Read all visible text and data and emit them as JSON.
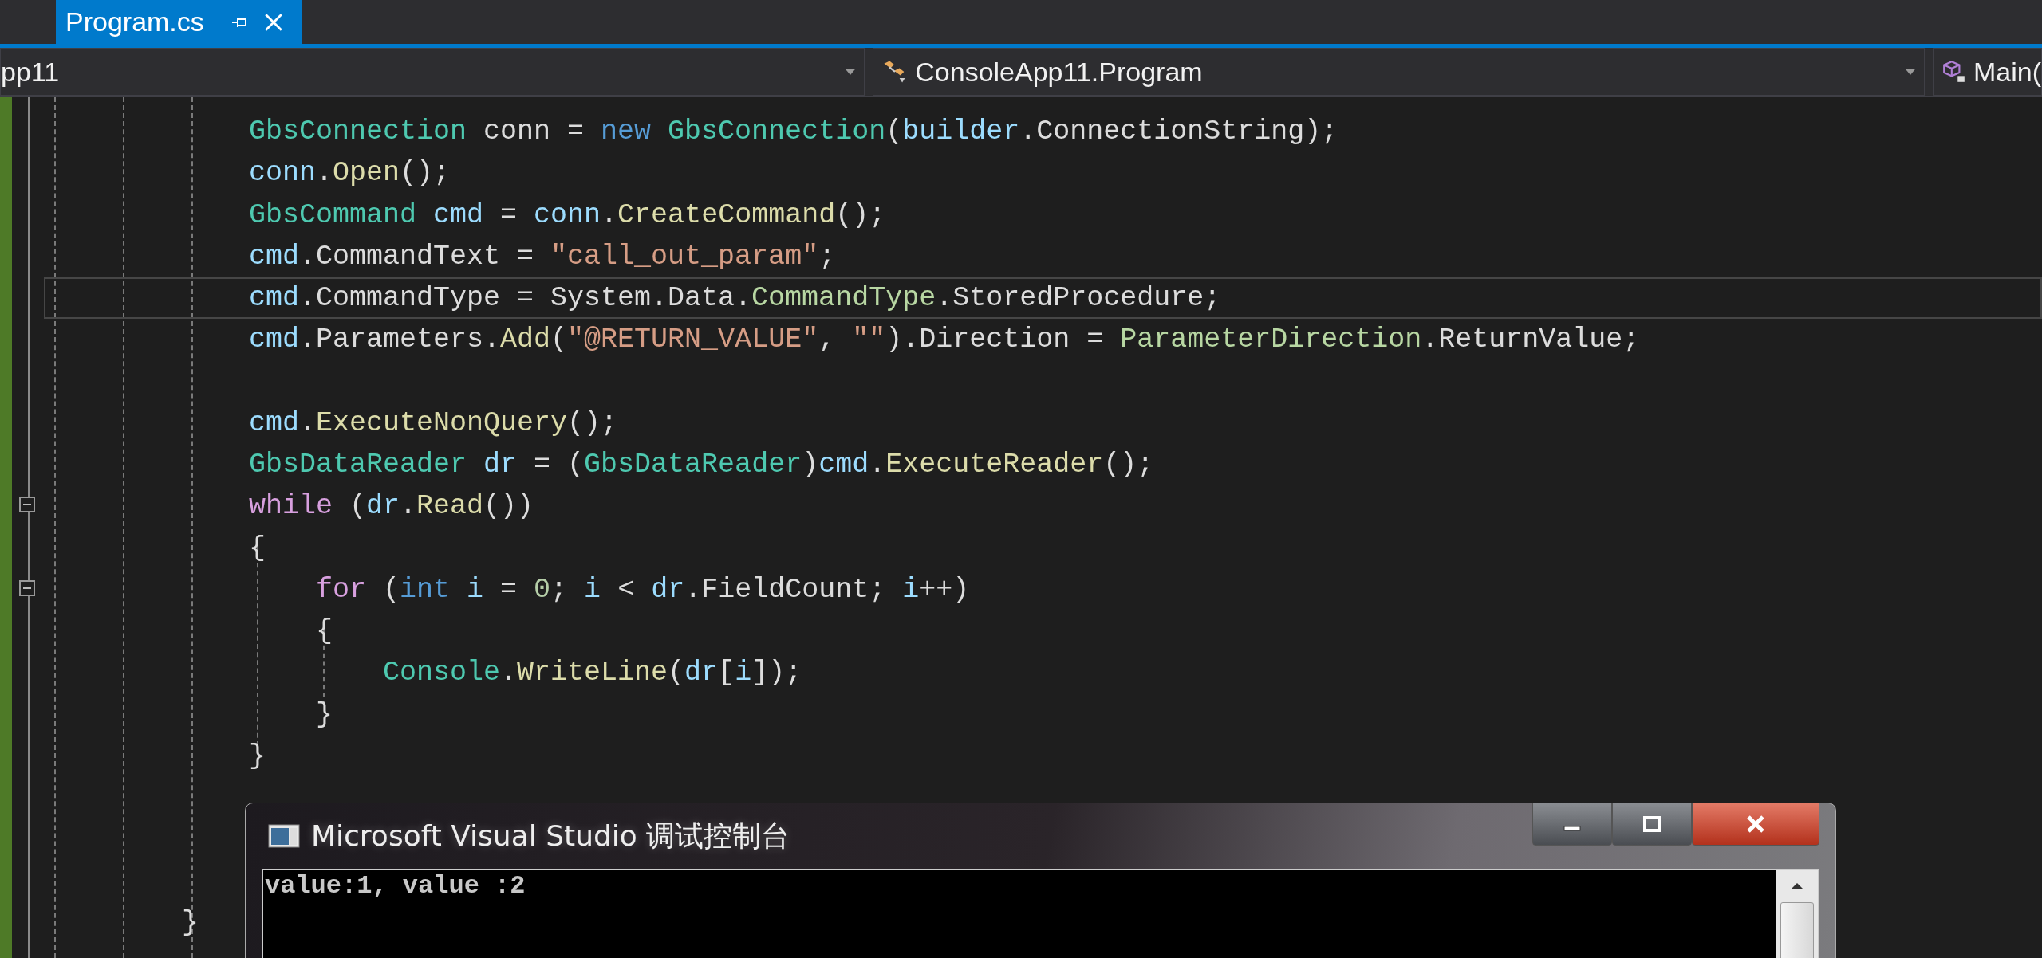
{
  "tabs": [
    {
      "label": "Program.cs",
      "selected": true
    }
  ],
  "navigation": {
    "project": "pp11",
    "type": "ConsoleApp11.Program",
    "member": "Main("
  },
  "code_lines": [
    {
      "kind": "block",
      "children": [
        {
          "kind": "code",
          "current": false,
          "collapse_box": false,
          "tokens": [
            {
              "kind": "type",
              "text": "GbsConnection"
            },
            {
              "kind": "plain",
              "text": " conn = "
            },
            {
              "kind": "keyword",
              "text": "new "
            },
            {
              "kind": "type",
              "text": "GbsConnection"
            },
            {
              "kind": "plain",
              "text": "("
            },
            {
              "kind": "variable",
              "text": "builder"
            },
            {
              "kind": "plain",
              "text": ".ConnectionString);"
            }
          ]
        },
        {
          "kind": "code",
          "current": false,
          "collapse_box": false,
          "tokens": [
            {
              "kind": "variable",
              "text": "conn"
            },
            {
              "kind": "plain",
              "text": "."
            },
            {
              "kind": "method",
              "text": "Open"
            },
            {
              "kind": "plain",
              "text": "();"
            }
          ]
        },
        {
          "kind": "code",
          "current": false,
          "collapse_box": false,
          "tokens": [
            {
              "kind": "type",
              "text": "GbsCommand "
            },
            {
              "kind": "variable",
              "text": "cmd"
            },
            {
              "kind": "plain",
              "text": " = "
            },
            {
              "kind": "variable",
              "text": "conn"
            },
            {
              "kind": "plain",
              "text": "."
            },
            {
              "kind": "method",
              "text": "CreateCommand"
            },
            {
              "kind": "plain",
              "text": "();"
            }
          ]
        },
        {
          "kind": "code",
          "current": false,
          "collapse_box": false,
          "tokens": [
            {
              "kind": "variable",
              "text": "cmd"
            },
            {
              "kind": "plain",
              "text": ".CommandText = "
            },
            {
              "kind": "string",
              "text": "\"call_out_param\""
            },
            {
              "kind": "plain",
              "text": ";"
            }
          ]
        },
        {
          "kind": "code",
          "current": true,
          "collapse_box": false,
          "tokens": [
            {
              "kind": "variable",
              "text": "cmd"
            },
            {
              "kind": "plain",
              "text": ".CommandType = System.Data."
            },
            {
              "kind": "enum",
              "text": "CommandType"
            },
            {
              "kind": "plain",
              "text": ".StoredProcedure;"
            }
          ]
        },
        {
          "kind": "code",
          "current": false,
          "collapse_box": false,
          "tokens": [
            {
              "kind": "variable",
              "text": "cmd"
            },
            {
              "kind": "plain",
              "text": ".Parameters."
            },
            {
              "kind": "method",
              "text": "Add"
            },
            {
              "kind": "plain",
              "text": "("
            },
            {
              "kind": "string",
              "text": "\"@RETURN_VALUE\""
            },
            {
              "kind": "plain",
              "text": ", "
            },
            {
              "kind": "string",
              "text": "\"\""
            },
            {
              "kind": "plain",
              "text": ").Direction = "
            },
            {
              "kind": "enum",
              "text": "ParameterDirection"
            },
            {
              "kind": "plain",
              "text": ".ReturnValue;"
            }
          ]
        },
        {
          "kind": "blank"
        },
        {
          "kind": "code",
          "current": false,
          "collapse_box": false,
          "tokens": [
            {
              "kind": "variable",
              "text": "cmd"
            },
            {
              "kind": "plain",
              "text": "."
            },
            {
              "kind": "method",
              "text": "ExecuteNonQuery"
            },
            {
              "kind": "plain",
              "text": "();"
            }
          ]
        },
        {
          "kind": "code",
          "current": false,
          "collapse_box": false,
          "tokens": [
            {
              "kind": "type",
              "text": "GbsDataReader "
            },
            {
              "kind": "variable",
              "text": "dr"
            },
            {
              "kind": "plain",
              "text": " = ("
            },
            {
              "kind": "type",
              "text": "GbsDataReader"
            },
            {
              "kind": "plain",
              "text": ")"
            },
            {
              "kind": "variable",
              "text": "cmd"
            },
            {
              "kind": "plain",
              "text": "."
            },
            {
              "kind": "method",
              "text": "ExecuteReader"
            },
            {
              "kind": "plain",
              "text": "();"
            }
          ]
        },
        {
          "kind": "code",
          "current": false,
          "collapse_box": true,
          "tokens": [
            {
              "kind": "control",
              "text": "while"
            },
            {
              "kind": "plain",
              "text": " ("
            },
            {
              "kind": "variable",
              "text": "dr"
            },
            {
              "kind": "plain",
              "text": "."
            },
            {
              "kind": "method",
              "text": "Read"
            },
            {
              "kind": "plain",
              "text": "())"
            }
          ]
        },
        {
          "kind": "code",
          "current": false,
          "collapse_box": false,
          "tokens": [
            {
              "kind": "plain",
              "text": "{"
            }
          ]
        },
        {
          "kind": "block",
          "children": [
            {
              "kind": "code",
              "current": false,
              "collapse_box": true,
              "tokens": [
                {
                  "kind": "control",
                  "text": "for"
                },
                {
                  "kind": "plain",
                  "text": " ("
                },
                {
                  "kind": "keyword",
                  "text": "int "
                },
                {
                  "kind": "variable",
                  "text": "i"
                },
                {
                  "kind": "plain",
                  "text": " = "
                },
                {
                  "kind": "number",
                  "text": "0"
                },
                {
                  "kind": "plain",
                  "text": "; "
                },
                {
                  "kind": "variable",
                  "text": "i"
                },
                {
                  "kind": "plain",
                  "text": " < "
                },
                {
                  "kind": "variable",
                  "text": "dr"
                },
                {
                  "kind": "plain",
                  "text": ".FieldCount; "
                },
                {
                  "kind": "variable",
                  "text": "i"
                },
                {
                  "kind": "plain",
                  "text": "++)"
                }
              ]
            },
            {
              "kind": "code",
              "current": false,
              "collapse_box": false,
              "tokens": [
                {
                  "kind": "plain",
                  "text": "{"
                }
              ]
            },
            {
              "kind": "block",
              "children": [
                {
                  "kind": "code",
                  "current": false,
                  "collapse_box": false,
                  "tokens": [
                    {
                      "kind": "type",
                      "text": "Console"
                    },
                    {
                      "kind": "plain",
                      "text": "."
                    },
                    {
                      "kind": "method",
                      "text": "WriteLine"
                    },
                    {
                      "kind": "plain",
                      "text": "("
                    },
                    {
                      "kind": "variable",
                      "text": "dr"
                    },
                    {
                      "kind": "plain",
                      "text": "["
                    },
                    {
                      "kind": "variable",
                      "text": "i"
                    },
                    {
                      "kind": "plain",
                      "text": "]);"
                    }
                  ]
                }
              ]
            },
            {
              "kind": "code",
              "current": false,
              "collapse_box": false,
              "tokens": [
                {
                  "kind": "plain",
                  "text": "}"
                }
              ]
            }
          ]
        },
        {
          "kind": "code",
          "current": false,
          "collapse_box": false,
          "tokens": [
            {
              "kind": "plain",
              "text": "}"
            }
          ]
        },
        {
          "kind": "blank"
        },
        {
          "kind": "blank"
        },
        {
          "kind": "blank"
        }
      ]
    },
    {
      "kind": "code",
      "current": false,
      "collapse_box": false,
      "tokens": [
        {
          "kind": "plain",
          "text": "}"
        }
      ]
    }
  ],
  "console_window": {
    "title": "Microsoft Visual Studio 调试控制台",
    "output": "value:1, value :2"
  }
}
